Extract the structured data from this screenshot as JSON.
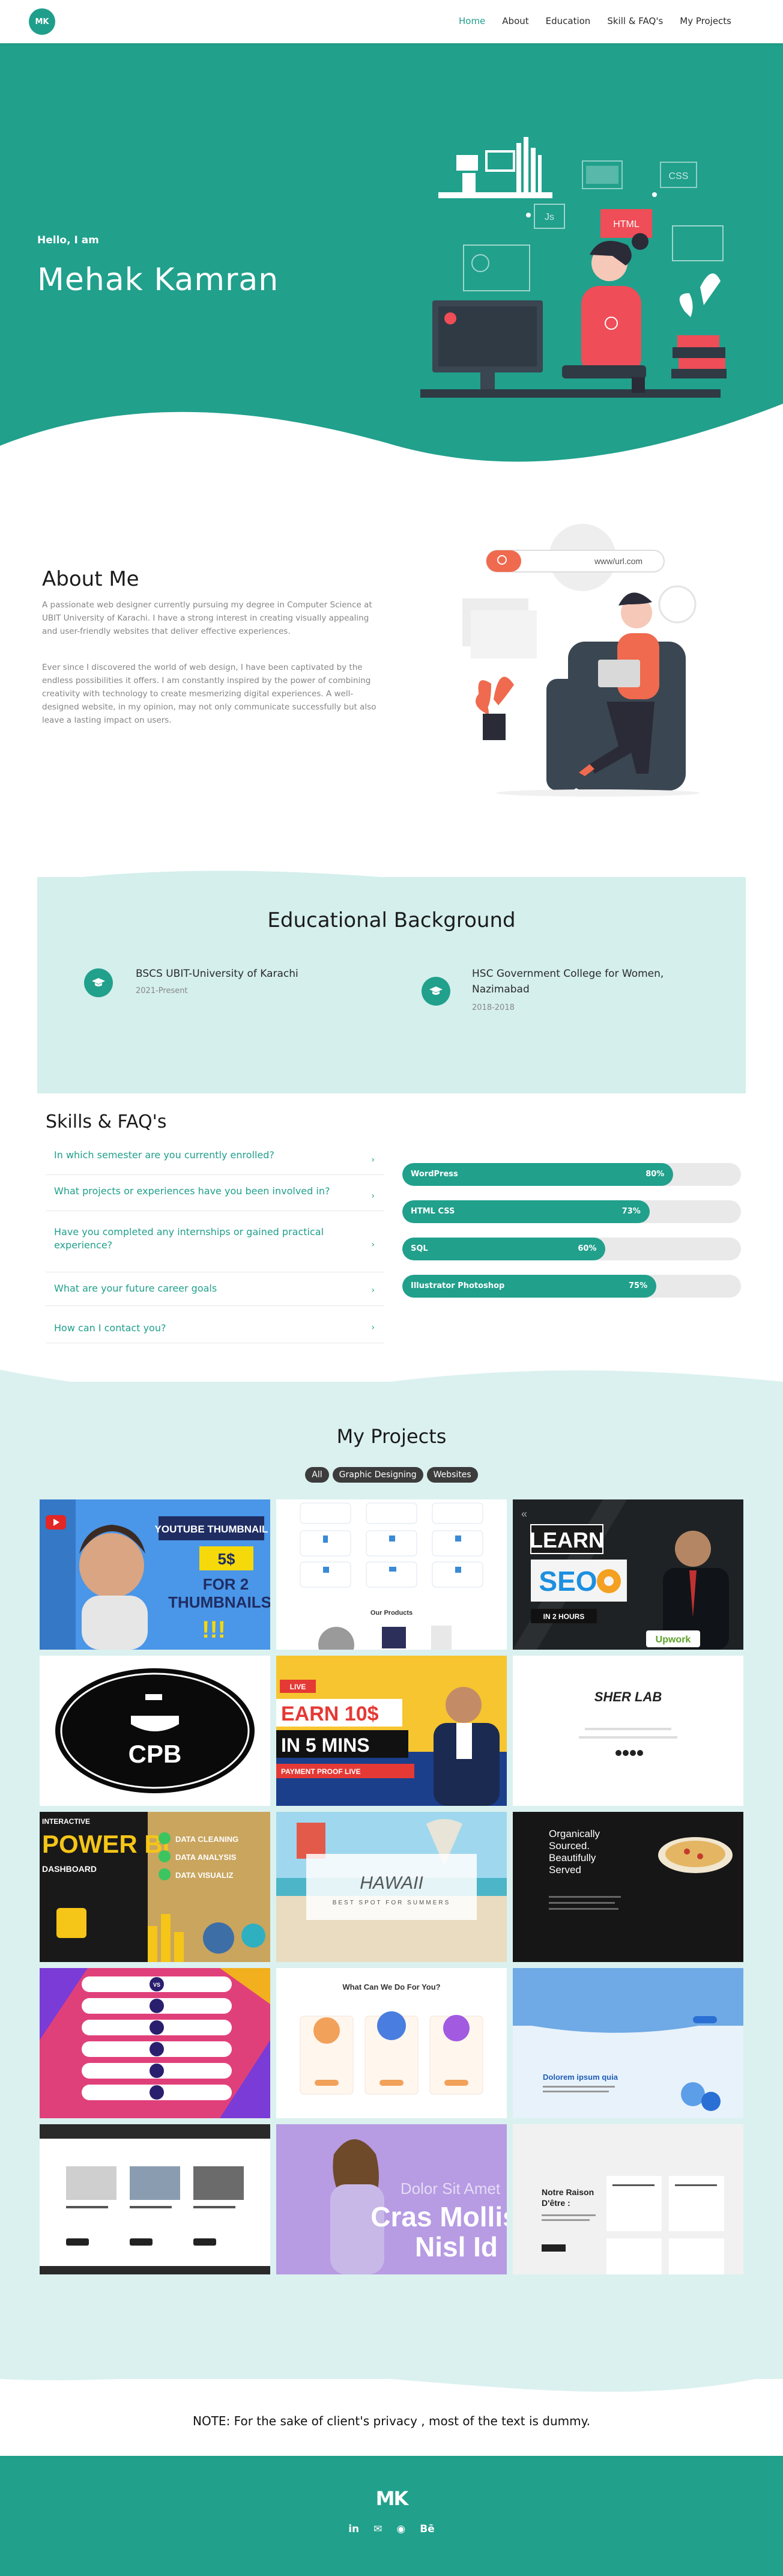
{
  "nav": {
    "logo": "MK",
    "items": [
      "Home",
      "About",
      "Education",
      "Skill & FAQ's",
      "My Projects"
    ],
    "active": "Home"
  },
  "hero": {
    "greeting": "Hello, I am",
    "name": "Mehak Kamran",
    "illustration_labels": [
      "Js",
      "CSS",
      "HTML"
    ]
  },
  "about": {
    "title": "About Me",
    "paragraph1": "A passionate web designer currently pursuing my degree in Computer Science at UBIT University of Karachi. I have a strong interest in creating visually appealing and user-friendly websites that deliver effective experiences.",
    "paragraph2": "Ever since I discovered the world of web design, I have been captivated by the endless possibilities it offers. I am constantly inspired by the power of combining creativity with technology to create mesmerizing digital experiences. A well-designed website, in my opinion, may not only communicate successfully but also leave a lasting impact on users.",
    "search_text": "www/url.com"
  },
  "education": {
    "title": "Educational Background",
    "items": [
      {
        "name": "BSCS UBIT-University of Karachi",
        "years": "2021-Present"
      },
      {
        "name": "HSC Government College for Women, Nazimabad",
        "years": "2018-2018"
      }
    ]
  },
  "skills": {
    "title": "Skills & FAQ's",
    "faqs": [
      "In which semester are you currently enrolled?",
      "What projects or experiences have you been involved in?",
      "Have you completed any internships or gained practical experience?",
      "What are your future career goals",
      "How can I contact you?"
    ],
    "bars": [
      {
        "label": "WordPress",
        "value": 80,
        "text": "80%"
      },
      {
        "label": "HTML CSS",
        "value": 73,
        "text": "73%"
      },
      {
        "label": "SQL",
        "value": 60,
        "text": "60%"
      },
      {
        "label": "Illustrator Photoshop",
        "value": 75,
        "text": "75%"
      }
    ]
  },
  "projects": {
    "title": "My Projects",
    "filters": [
      "All",
      "Graphic Designing",
      "Websites"
    ],
    "tiles": {
      "t1": {
        "line1": "YOUTUBE THUMBNAIL",
        "price": "5$",
        "line2": "FOR 2",
        "line3": "THUMBNAILS",
        "marks": "!!!"
      },
      "t2": {
        "title": "Our Products"
      },
      "t3": {
        "line1": "LEARN",
        "line2": "SEO",
        "line3": "IN 2 HOURS",
        "brand": "Upwork"
      },
      "t4": {
        "text": "CPB"
      },
      "t5": {
        "live": "LIVE",
        "line1": "EARN 10$",
        "line2": "IN 5 MINS",
        "line3": "PAYMENT PROOF LIVE"
      },
      "t6": {
        "logo": "SHER LAB"
      },
      "t7": {
        "line1": "INTERACTIVE",
        "line2": "POWER BI",
        "line3": "DASHBOARD",
        "checks": [
          "DATA CLEANING",
          "DATA ANALYSIS",
          "DATA VISUALIZ"
        ]
      },
      "t8": {
        "title": "HAWAII",
        "subtitle": "BEST SPOT FOR SUMMERS"
      },
      "t9": {
        "line1": "Organically",
        "line2": "Sourced.",
        "line3": "Beautifully",
        "line4": "Served"
      },
      "t10": {
        "vs": "VS"
      },
      "t11": {
        "title": "What Can We Do For You?"
      },
      "t12": {
        "heading": "Dolorem ipsum quia"
      },
      "t13": {},
      "t14": {
        "line1": "Dolor Sit Amet",
        "line2": "Cras Mollis",
        "line3": "Nisl Id"
      },
      "t15": {
        "line1": "Notre Raison",
        "line2": "D'être :"
      }
    }
  },
  "note": "NOTE: For the sake of client's privacy , most of the text is dummy.",
  "footer": {
    "logo": "MK",
    "social": [
      "in",
      "✉",
      "◉",
      "Bē"
    ]
  },
  "colors": {
    "teal": "#21a08c",
    "light_teal": "#d4efec"
  }
}
